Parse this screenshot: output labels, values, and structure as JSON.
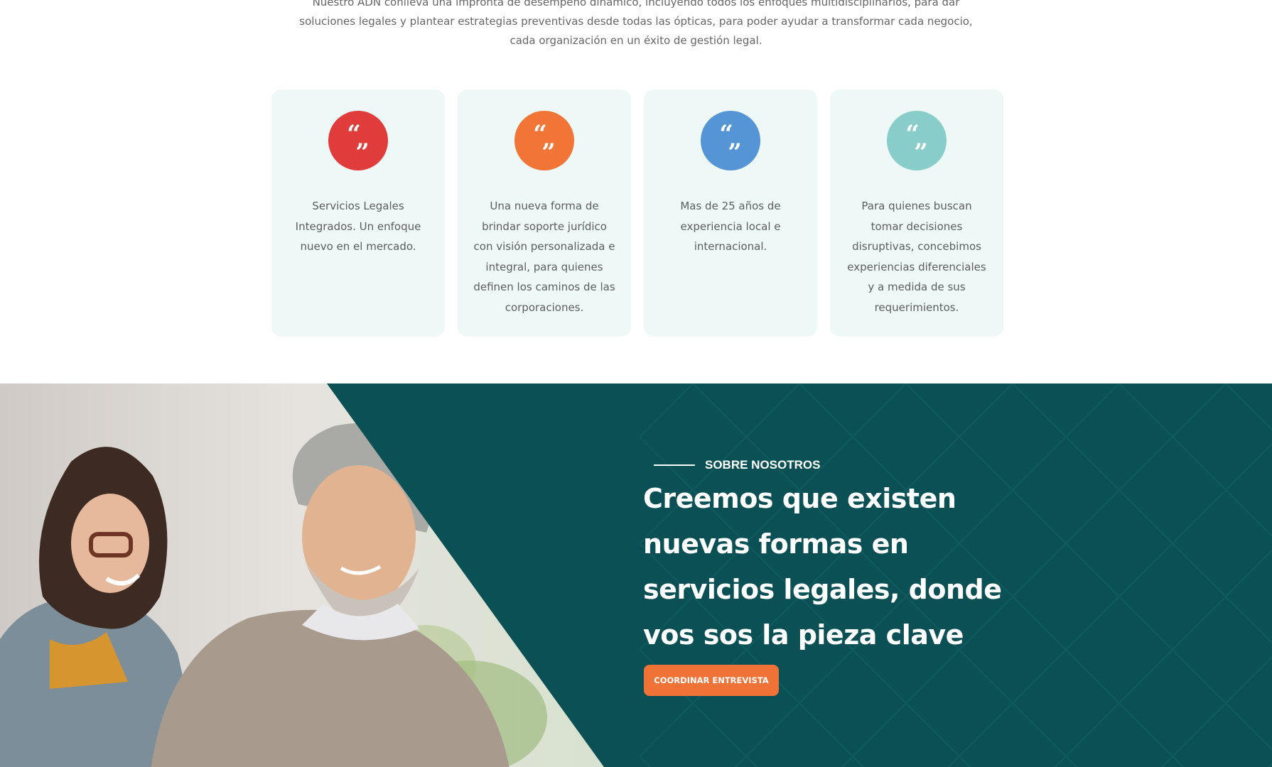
{
  "intro": {
    "text": "Nuestro ADN conlleva una impronta de desempeño dinámico, incluyendo todos los enfoques multidisciplinarios, para dar soluciones legales y plantear estrategias preventivas desde todas las ópticas, para poder ayudar a transformar cada negocio, cada organización en un éxito de gestión legal."
  },
  "cards": [
    {
      "icon": "quote-icon",
      "color": "#e03c3c",
      "text": "Servicios Legales Integrados. Un enfoque nuevo en el mercado."
    },
    {
      "icon": "quote-icon",
      "color": "#f07536",
      "text": "Una nueva forma de brindar soporte jurídico con visión personalizada e integral, para quienes definen los caminos de las corporaciones."
    },
    {
      "icon": "quote-icon",
      "color": "#5595d6",
      "text": "Mas de 25 años de experiencia local e internacional."
    },
    {
      "icon": "quote-icon",
      "color": "#88cdc9",
      "text": "Para quienes buscan tomar decisiones disruptivas, concebimos experiencias diferenciales y a medida de sus requerimientos."
    }
  ],
  "hero": {
    "eyebrow": "SOBRE NOSOTROS",
    "title": "Creemos que existen nuevas formas en servicios legales, donde vos sos la pieza clave",
    "cta": "COORDINAR ENTREVISTA",
    "background_color": "#0b5055",
    "accent_color": "#ef7237",
    "image": "photo-two-people-smiling-at-laptop"
  }
}
